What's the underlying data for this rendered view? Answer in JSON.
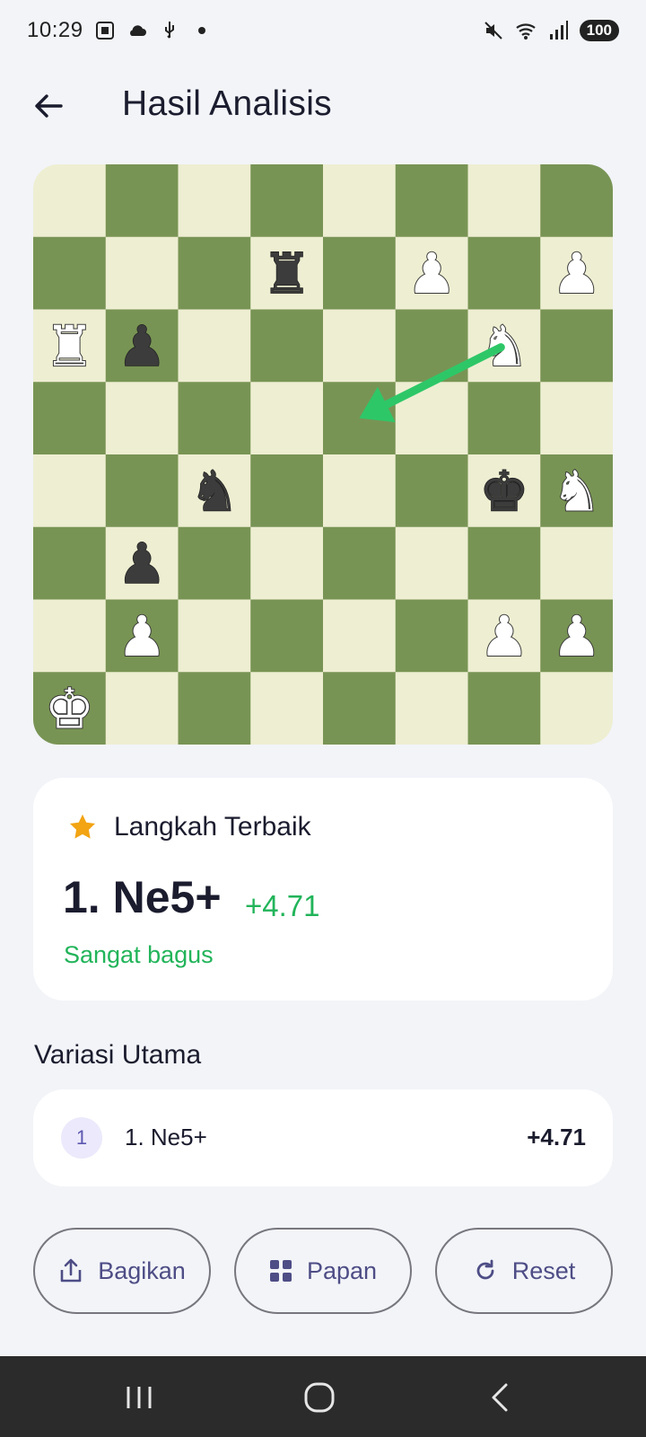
{
  "status_bar": {
    "time": "10:29",
    "battery": "100",
    "icons": [
      "screenshot-icon",
      "cloud-icon",
      "usb-icon",
      "dot-icon",
      "mute-icon",
      "wifi-icon",
      "signal-icon"
    ]
  },
  "header": {
    "title": "Hasil Analisis",
    "back_icon": "arrow-left-icon"
  },
  "board": {
    "light_color": "#eeeed2",
    "dark_color": "#789454",
    "arrow_color": "#2ec768",
    "arrow_from": "g6",
    "arrow_to": "e5",
    "pieces": [
      {
        "square": "d7",
        "piece": "R",
        "color": "black"
      },
      {
        "square": "f7",
        "piece": "P",
        "color": "white"
      },
      {
        "square": "h7",
        "piece": "P",
        "color": "white"
      },
      {
        "square": "a6",
        "piece": "R",
        "color": "white"
      },
      {
        "square": "b6",
        "piece": "P",
        "color": "black"
      },
      {
        "square": "g6",
        "piece": "N",
        "color": "white"
      },
      {
        "square": "c4",
        "piece": "N",
        "color": "black"
      },
      {
        "square": "g4",
        "piece": "K",
        "color": "black"
      },
      {
        "square": "h4",
        "piece": "N",
        "color": "white"
      },
      {
        "square": "b3",
        "piece": "P",
        "color": "black"
      },
      {
        "square": "b2",
        "piece": "P",
        "color": "white"
      },
      {
        "square": "g2",
        "piece": "P",
        "color": "white"
      },
      {
        "square": "h2",
        "piece": "P",
        "color": "white"
      },
      {
        "square": "a1",
        "piece": "K",
        "color": "white"
      }
    ]
  },
  "best_move": {
    "label": "Langkah Terbaik",
    "move": "1. Ne5+",
    "eval": "+4.71",
    "quality": "Sangat bagus",
    "accent": "#22b45a",
    "star_color": "#f2a413"
  },
  "main_variation": {
    "title": "Variasi Utama",
    "lines": [
      {
        "index": "1",
        "moves": "1. Ne5+",
        "eval": "+4.71"
      }
    ]
  },
  "actions": {
    "share_label": "Bagikan",
    "board_label": "Papan",
    "reset_label": "Reset"
  }
}
